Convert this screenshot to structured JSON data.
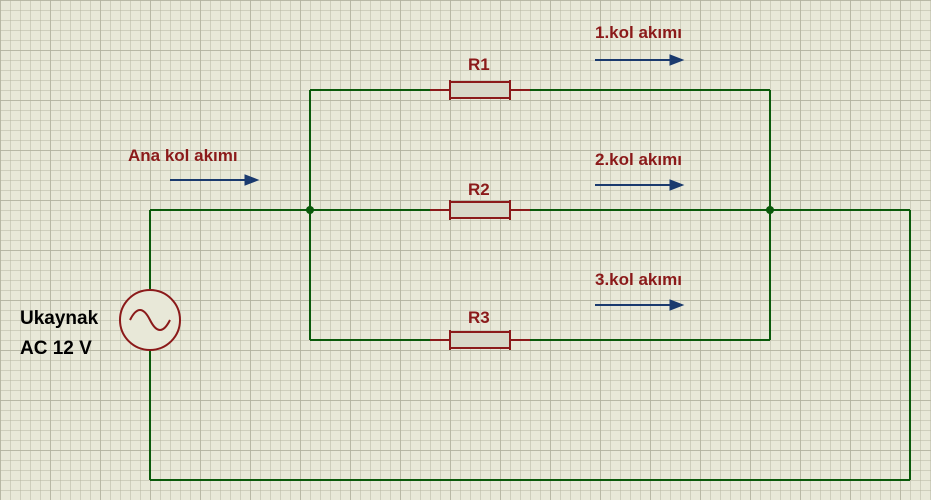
{
  "source": {
    "name": "Ukaynak",
    "voltage": "AC 12 V"
  },
  "mainBranch": {
    "label": "Ana kol akımı"
  },
  "resistors": {
    "r1": {
      "name": "R1",
      "branchLabel": "1.kol akımı"
    },
    "r2": {
      "name": "R2",
      "branchLabel": "2.kol akımı"
    },
    "r3": {
      "name": "R3",
      "branchLabel": "3.kol akımı"
    }
  },
  "chart_data": {
    "type": "circuit-diagram",
    "source": {
      "type": "AC",
      "voltage_v": 12,
      "label": "Ukaynak"
    },
    "topology": "parallel",
    "components": [
      {
        "ref": "R1",
        "type": "resistor",
        "branch": 1
      },
      {
        "ref": "R2",
        "type": "resistor",
        "branch": 2
      },
      {
        "ref": "R3",
        "type": "resistor",
        "branch": 3
      }
    ],
    "currents": [
      {
        "name": "Ana kol akımı",
        "description": "main branch current"
      },
      {
        "name": "1.kol akımı",
        "description": "branch 1 current through R1"
      },
      {
        "name": "2.kol akımı",
        "description": "branch 2 current through R2"
      },
      {
        "name": "3.kol akımı",
        "description": "branch 3 current through R3"
      }
    ]
  }
}
